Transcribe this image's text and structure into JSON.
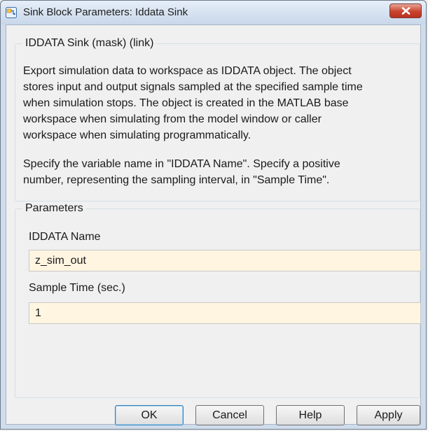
{
  "window": {
    "title": "Sink Block Parameters: Iddata Sink",
    "app_icon": "simulink-block-icon",
    "close_icon": "close-icon",
    "close_button_color": "#c9432e"
  },
  "mask_group": {
    "title": "IDDATA Sink (mask) (link)",
    "description_lines": [
      "Export simulation data to workspace as IDDATA object. The object",
      "stores input and output signals sampled at the specified sample time",
      "when simulation stops. The object is created in the MATLAB base",
      "workspace when simulating from the model window or caller",
      "workspace when simulating programmatically."
    ],
    "instruction_lines": [
      "Specify the variable name in \"IDDATA Name\". Specify a positive",
      "number, representing the sampling interval, in \"Sample Time\"."
    ]
  },
  "parameters_group": {
    "title": "Parameters",
    "fields": [
      {
        "label": "IDDATA Name",
        "value": "z_sim_out"
      },
      {
        "label": "Sample Time (sec.)",
        "value": "1"
      }
    ],
    "input_bg_color": "#fff5e1"
  },
  "buttons": {
    "ok": "OK",
    "cancel": "Cancel",
    "help": "Help",
    "apply": "Apply"
  }
}
